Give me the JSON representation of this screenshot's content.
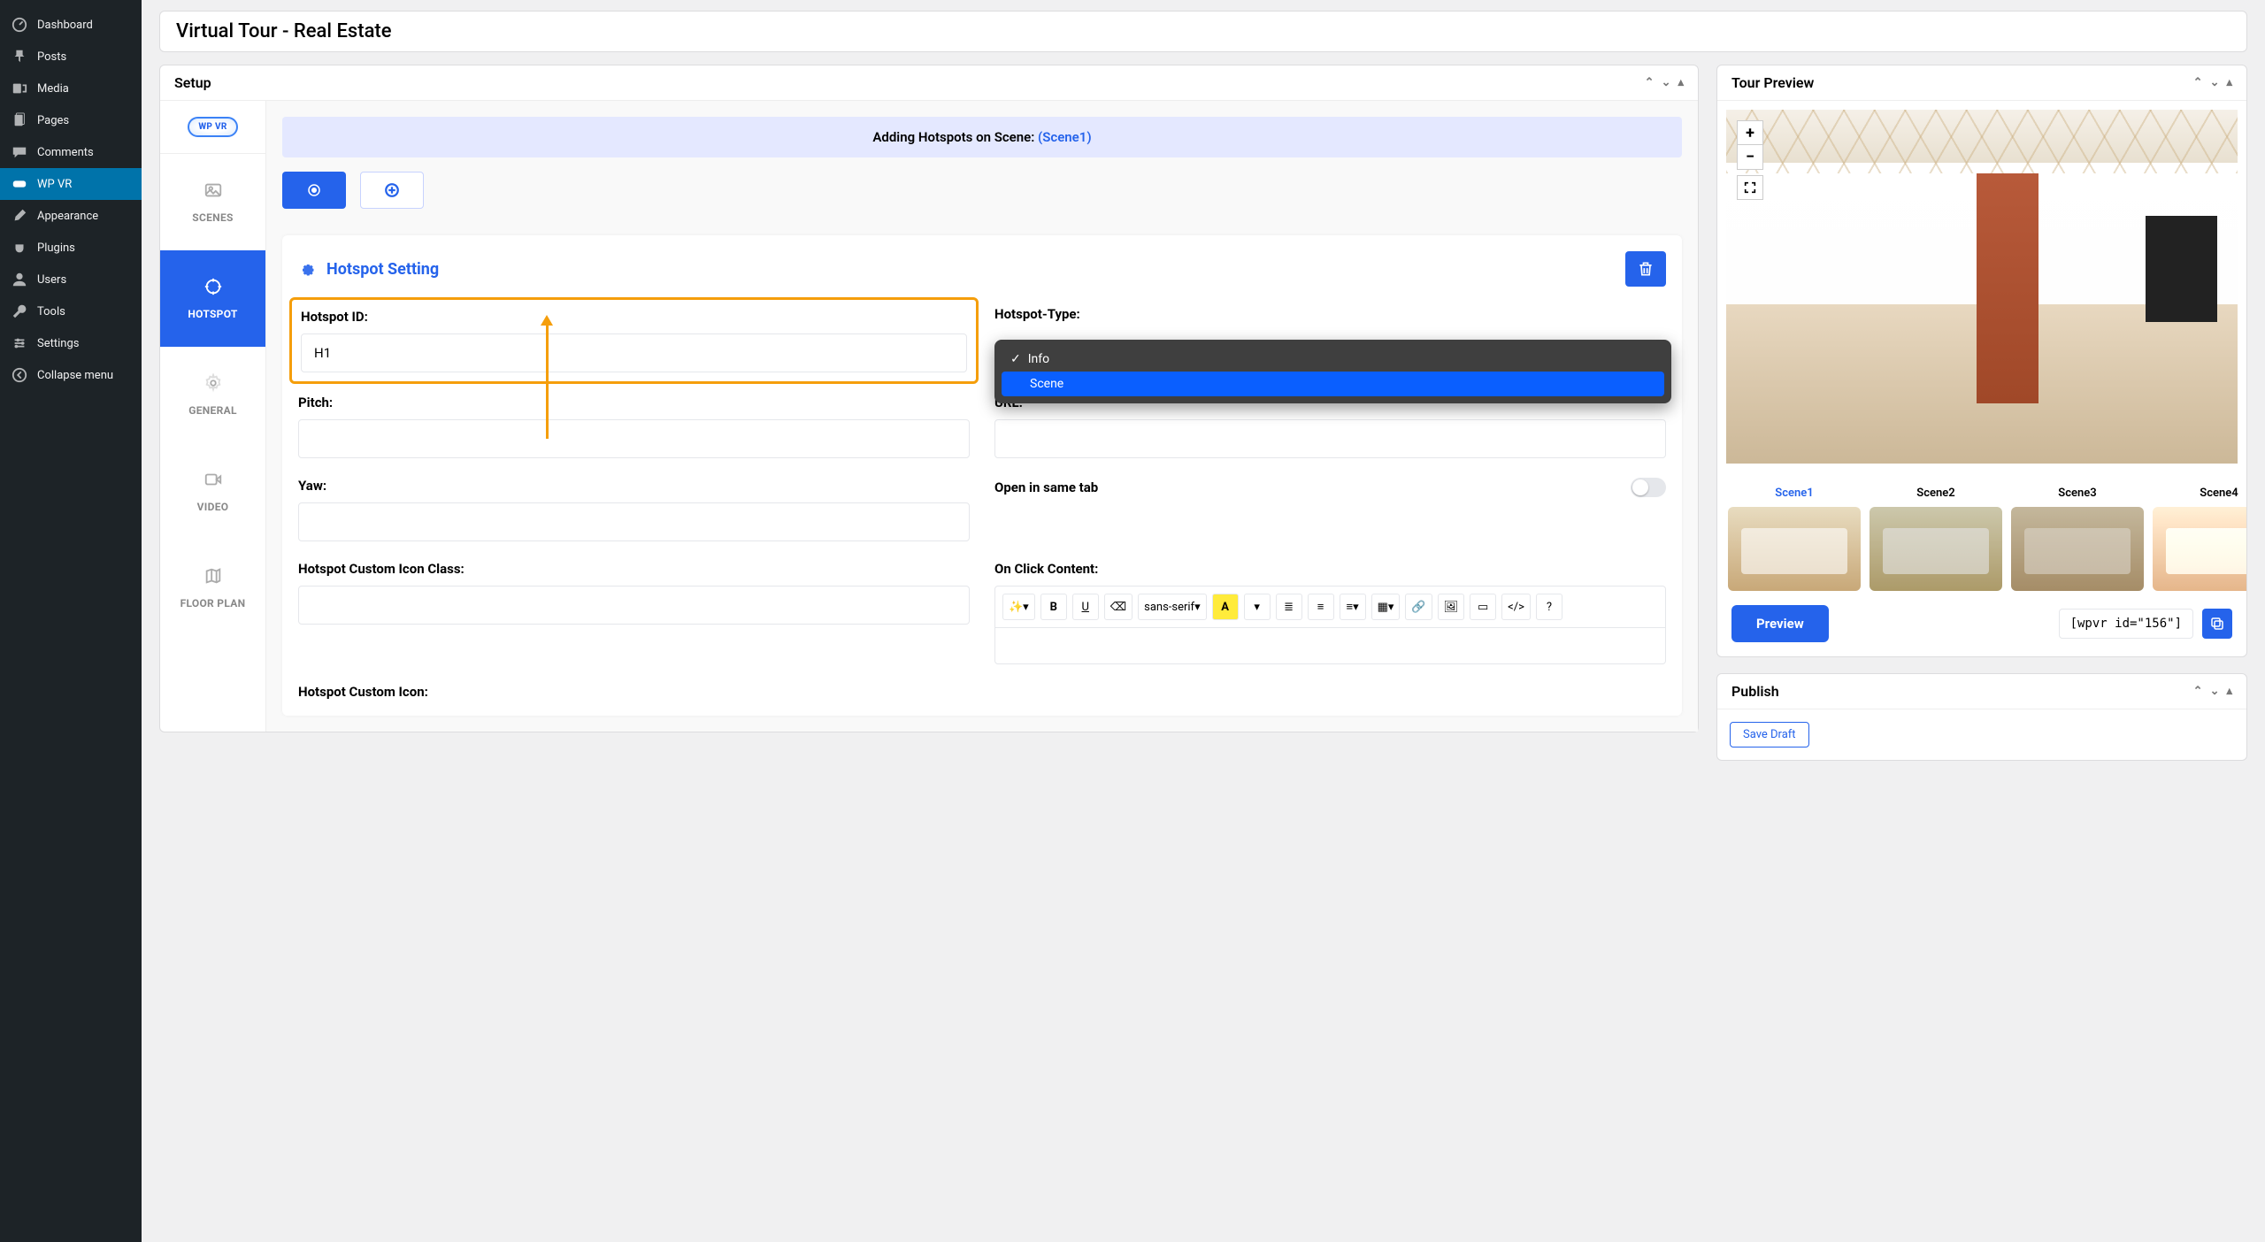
{
  "page_title": "Virtual Tour - Real Estate",
  "wp_menu": [
    {
      "label": "Dashboard",
      "icon": "dashboard"
    },
    {
      "label": "Posts",
      "icon": "pin"
    },
    {
      "label": "Media",
      "icon": "media"
    },
    {
      "label": "Pages",
      "icon": "pages"
    },
    {
      "label": "Comments",
      "icon": "comment"
    },
    {
      "label": "WP VR",
      "icon": "wpvr",
      "active": true
    },
    {
      "label": "Appearance",
      "icon": "brush"
    },
    {
      "label": "Plugins",
      "icon": "plug"
    },
    {
      "label": "Users",
      "icon": "user"
    },
    {
      "label": "Tools",
      "icon": "wrench"
    },
    {
      "label": "Settings",
      "icon": "settings"
    },
    {
      "label": "Collapse menu",
      "icon": "collapse"
    }
  ],
  "setup": {
    "title": "Setup",
    "logo_text": "WP VR",
    "tabs": [
      {
        "label": "SCENES"
      },
      {
        "label": "HOTSPOT",
        "active": true
      },
      {
        "label": "GENERAL"
      },
      {
        "label": "VIDEO"
      },
      {
        "label": "FLOOR PLAN"
      }
    ],
    "banner_prefix": "Adding Hotspots on Scene: ",
    "banner_scene": "(Scene1)",
    "hotspot_section_title": "Hotspot Setting",
    "fields": {
      "hotspot_id_label": "Hotspot ID:",
      "hotspot_id_value": "H1",
      "hotspot_type_label": "Hotspot-Type:",
      "hotspot_type_options": [
        "Info",
        "Scene"
      ],
      "hotspot_type_selected": "Info",
      "hotspot_type_highlight": "Scene",
      "pitch_label": "Pitch:",
      "pitch_value": "",
      "url_label": "URL:",
      "url_value": "",
      "yaw_label": "Yaw:",
      "yaw_value": "",
      "open_same_tab_label": "Open in same tab",
      "icon_class_label": "Hotspot Custom Icon Class:",
      "icon_class_value": "",
      "on_click_label": "On Click Content:",
      "custom_icon_label": "Hotspot Custom Icon:",
      "rte_font_option": "sans-serif"
    }
  },
  "preview": {
    "title": "Tour Preview",
    "zoom_in": "+",
    "zoom_out": "−",
    "scenes": [
      "Scene1",
      "Scene2",
      "Scene3",
      "Scene4"
    ],
    "active_scene": "Scene1",
    "preview_btn": "Preview",
    "shortcode": "[wpvr id=\"156\"]"
  },
  "publish": {
    "title": "Publish",
    "save_draft": "Save Draft"
  }
}
